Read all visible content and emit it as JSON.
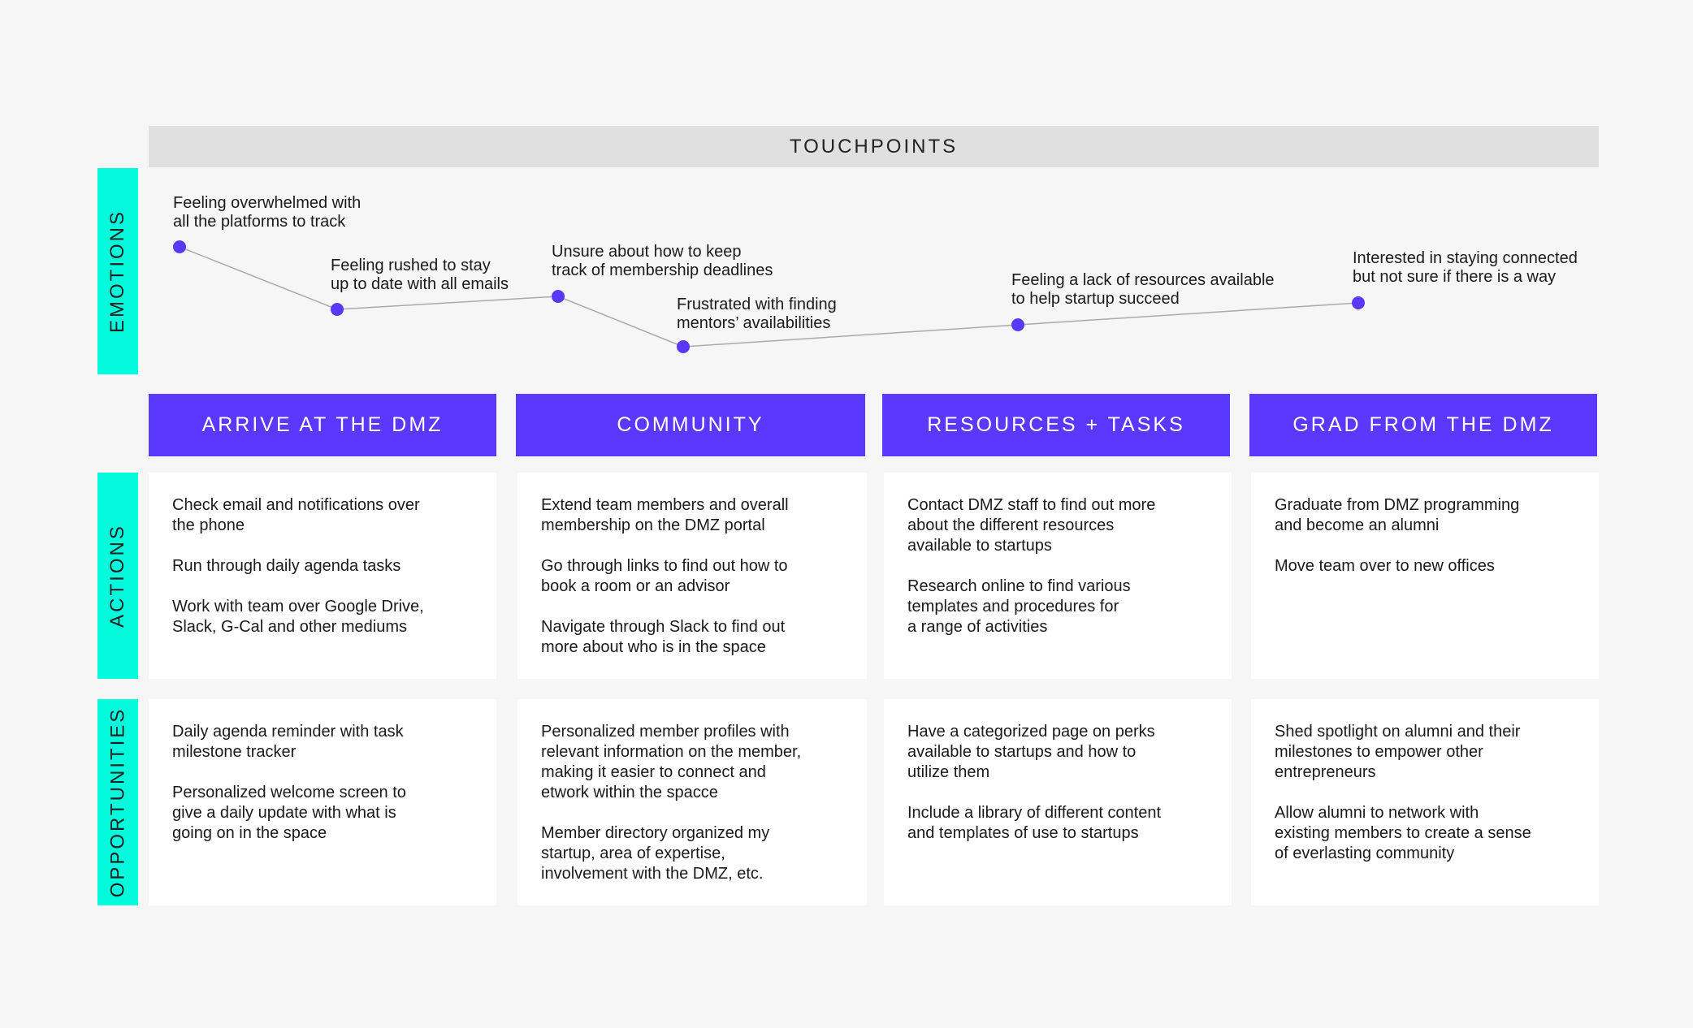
{
  "touchpoints_title": "TOUCHPOINTS",
  "row_labels": {
    "emotions": "EMOTIONS",
    "actions": "ACTIONS",
    "opportunities": "OPPORTUNITIES"
  },
  "colors": {
    "accent": "#5a38fd",
    "row_label": "#03fbdd",
    "header_bar": "#e0e0e0",
    "line": "#aaaaaa"
  },
  "emotions": [
    {
      "label": "Feeling overwhelmed with\nall the platforms to track"
    },
    {
      "label": "Feeling rushed to stay\nup to date with all emails"
    },
    {
      "label": "Unsure about how to keep\ntrack of membership deadlines"
    },
    {
      "label": "Frustrated with finding\nmentors’ availabilities"
    },
    {
      "label": "Feeling a lack of resources available\nto help startup succeed"
    },
    {
      "label": "Interested in staying connected\nbut not sure if there is a way"
    }
  ],
  "stages": [
    {
      "title": "ARRIVE AT THE DMZ",
      "actions": [
        "Check email and notifications over\nthe phone",
        "Run through daily agenda tasks",
        "Work with team over Google Drive,\nSlack, G-Cal and other mediums"
      ],
      "opportunities": [
        "Daily agenda reminder with task\nmilestone tracker",
        "Personalized welcome screen to\ngive a daily update with what is\ngoing on in the space"
      ]
    },
    {
      "title": "COMMUNITY",
      "actions": [
        "Extend team members and overall\nmembership on the DMZ portal",
        "Go through links to find out how to\nbook a room or an advisor",
        "Navigate through Slack to find out\nmore about who is in the space"
      ],
      "opportunities": [
        "Personalized member profiles with\nrelevant information on the member,\nmaking it easier to connect and\network within the spacce",
        "Member directory organized my\nstartup, area of expertise,\ninvolvement with the DMZ, etc."
      ]
    },
    {
      "title": "RESOURCES + TASKS",
      "actions": [
        "Contact DMZ staff to find out more\nabout the different resources\navailable to startups",
        "Research online to find various\ntemplates and procedures for\na range of activities"
      ],
      "opportunities": [
        "Have a categorized page on perks\navailable to startups and how to\nutilize them",
        "Include a library of different content\nand templates of use to startups"
      ]
    },
    {
      "title": "GRAD FROM THE DMZ",
      "actions": [
        "Graduate from DMZ programming\nand become an alumni",
        "Move team over to new offices"
      ],
      "opportunities": [
        "Shed spotlight on alumni and their\nmilestones to empower other\nentrepreneurs",
        "Allow alumni to network with\nexisting members to create a sense\nof everlasting community"
      ]
    }
  ]
}
